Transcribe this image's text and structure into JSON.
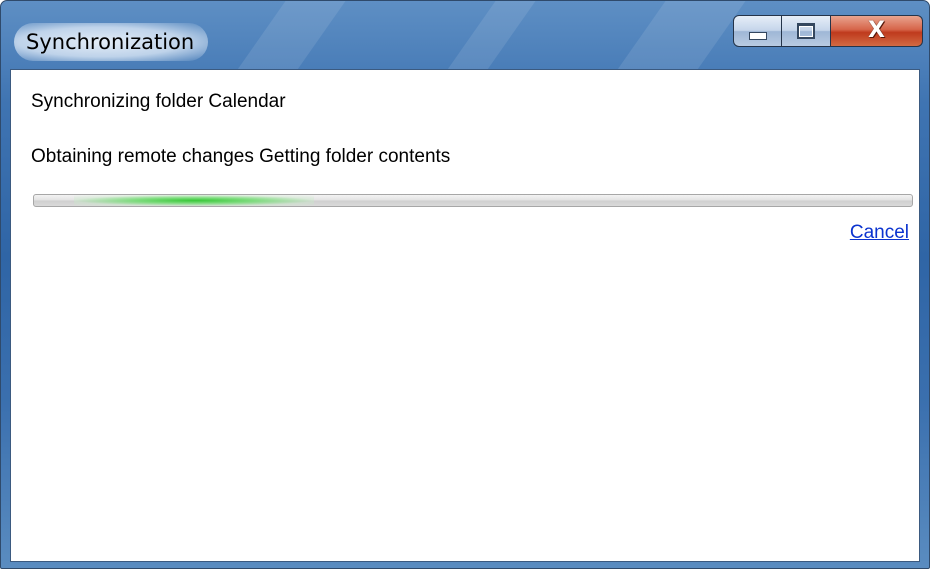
{
  "window": {
    "title": "Synchronization"
  },
  "caption_buttons": {
    "minimize_icon": "minimize-icon",
    "maximize_icon": "maximize-icon",
    "close_icon": "close-icon",
    "close_glyph": "X"
  },
  "dialog": {
    "folder_line": "Synchronizing folder Calendar",
    "status_line": "Obtaining remote changes Getting folder contents",
    "progress_style": "marquee",
    "cancel_label": "Cancel"
  },
  "colors": {
    "link": "#0b33cf",
    "progress_glow": "#37c837",
    "close_button": "#c8452a"
  }
}
